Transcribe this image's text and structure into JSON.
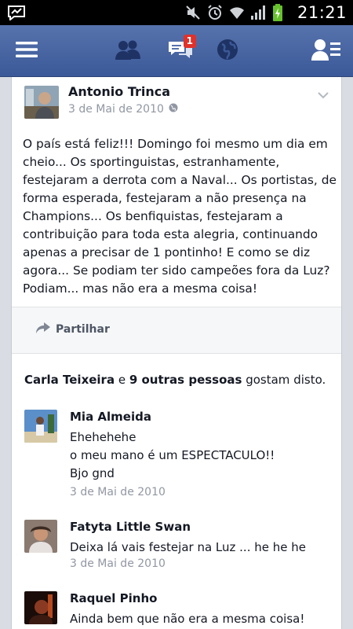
{
  "status_bar": {
    "time": "21:21",
    "icons": [
      "messenger-icon",
      "mute-icon",
      "alarm-icon",
      "wifi-icon",
      "signal-icon",
      "battery-charging-icon"
    ]
  },
  "nav": {
    "icons": [
      "menu-icon",
      "friend-requests-icon",
      "messages-icon",
      "notifications-globe-icon",
      "friends-list-icon"
    ],
    "messages_badge": "1",
    "color": "#3b5998"
  },
  "post": {
    "author": "Antonio Trinca",
    "date": "3 de Mai de 2010",
    "text": "O país está feliz!!! Domingo foi mesmo um dia em cheio... Os sportinguistas, estranhamente, festejaram a derrota com a Naval... Os portistas, de forma esperada, festejaram a não presença na Champions... Os benfiquistas, festejaram a contribuição para toda esta alegria, continuando apenas a precisar de 1 pontinho! E como se diz agora... Se podiam ter sido campeões fora da Luz? Podiam... mas não era a mesma coisa!",
    "share_label": "Partilhar"
  },
  "likes": {
    "first_name": "Carla Teixeira",
    "and_text": " e ",
    "others": "9 outras pessoas",
    "suffix": " gostam disto."
  },
  "comments": [
    {
      "name": "Mia Almeida",
      "lines": [
        "Ehehehehe",
        "o meu mano é um ESPECTACULO!!",
        "Bjo gnd"
      ],
      "date": "3 de Mai de 2010"
    },
    {
      "name": "Fatyta Little Swan",
      "lines": [
        "Deixa lá vais festejar na Luz ... he he he"
      ],
      "date": "3 de Mai de 2010"
    },
    {
      "name": "Raquel Pinho",
      "lines": [
        "Ainda bem que não era a mesma coisa!"
      ],
      "date": ""
    }
  ]
}
